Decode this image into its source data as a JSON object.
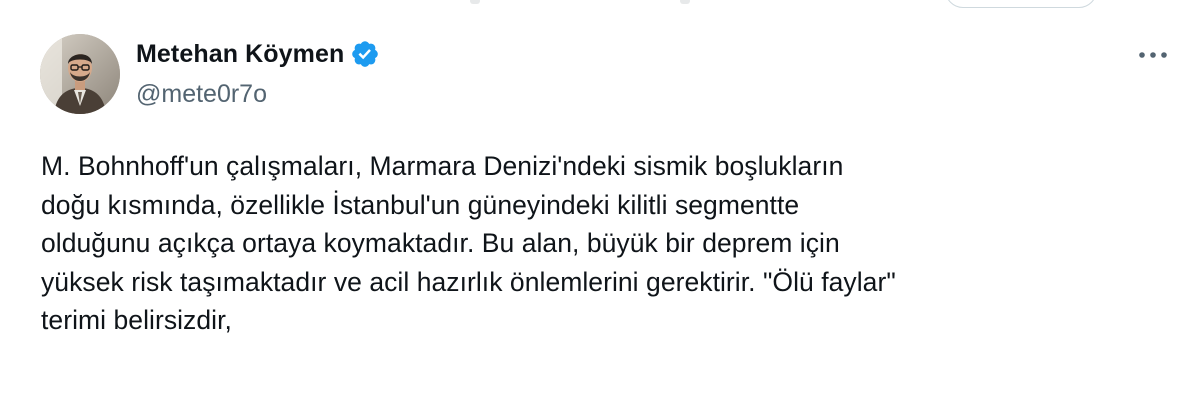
{
  "author": {
    "display_name": "Metehan Köymen",
    "handle": "@mete0r7o",
    "verified": true,
    "avatar": "profile-photo"
  },
  "tweet": {
    "text": "M. Bohnhoff'un çalışmaları, Marmara Denizi'ndeki sismik boşlukların\ndoğu kısmında, özellikle İstanbul'un güneyindeki kilitli segmentte\nolduğunu açıkça ortaya koymaktadır. Bu alan, büyük bir deprem için\nyüksek risk taşımaktadır ve acil hazırlık önlemlerini gerektirir. \"Ölü faylar\"\nterimi belirsizdir,"
  },
  "icons": {
    "verified": "verified-badge-icon",
    "more": "more-horizontal-icon"
  },
  "colors": {
    "text_primary": "#0f1419",
    "text_secondary": "#536471",
    "verified_blue": "#1d9bf0",
    "border": "#cfd9de"
  }
}
